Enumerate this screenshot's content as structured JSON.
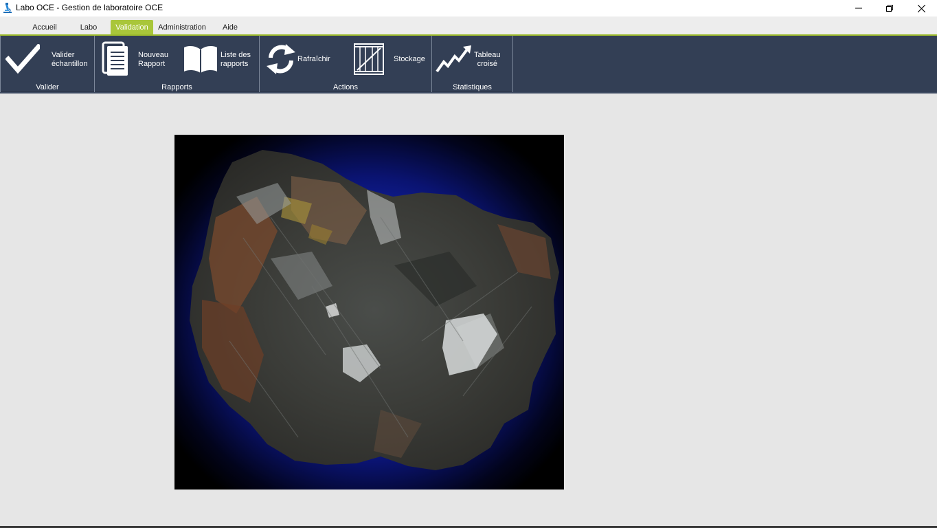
{
  "window": {
    "title": "Labo OCE - Gestion de laboratoire OCE",
    "minimize_icon": "minimize-icon",
    "restore_icon": "restore-icon",
    "close_icon": "close-icon"
  },
  "menu": {
    "tabs": [
      {
        "label": "Accueil"
      },
      {
        "label": "Labo"
      },
      {
        "label": "Validation",
        "active": true
      },
      {
        "label": "Administration"
      },
      {
        "label": "Aide"
      }
    ],
    "accent": "#a9c63a"
  },
  "ribbon": {
    "background": "#333f55",
    "groups": {
      "valider": {
        "label": "Valider",
        "buttons": [
          {
            "label": "Valider\néchantillon",
            "icon": "checkmark-icon"
          }
        ]
      },
      "rapports": {
        "label": "Rapports",
        "buttons": [
          {
            "label": "Nouveau\nRapport",
            "icon": "document-icon"
          },
          {
            "label": "Liste des\nrapports",
            "icon": "book-icon"
          }
        ]
      },
      "actions": {
        "label": "Actions",
        "buttons": [
          {
            "label": "Rafraîchir",
            "icon": "refresh-icon"
          },
          {
            "label": "Stockage",
            "icon": "storage-crate-icon"
          }
        ]
      },
      "statistiques": {
        "label": "Statistiques",
        "buttons": [
          {
            "label": "Tableau\ncroisé",
            "icon": "trend-chart-icon"
          }
        ]
      }
    }
  },
  "main": {
    "image": {
      "subject": "mineral-specimen",
      "background_color": "#1527b8"
    }
  }
}
